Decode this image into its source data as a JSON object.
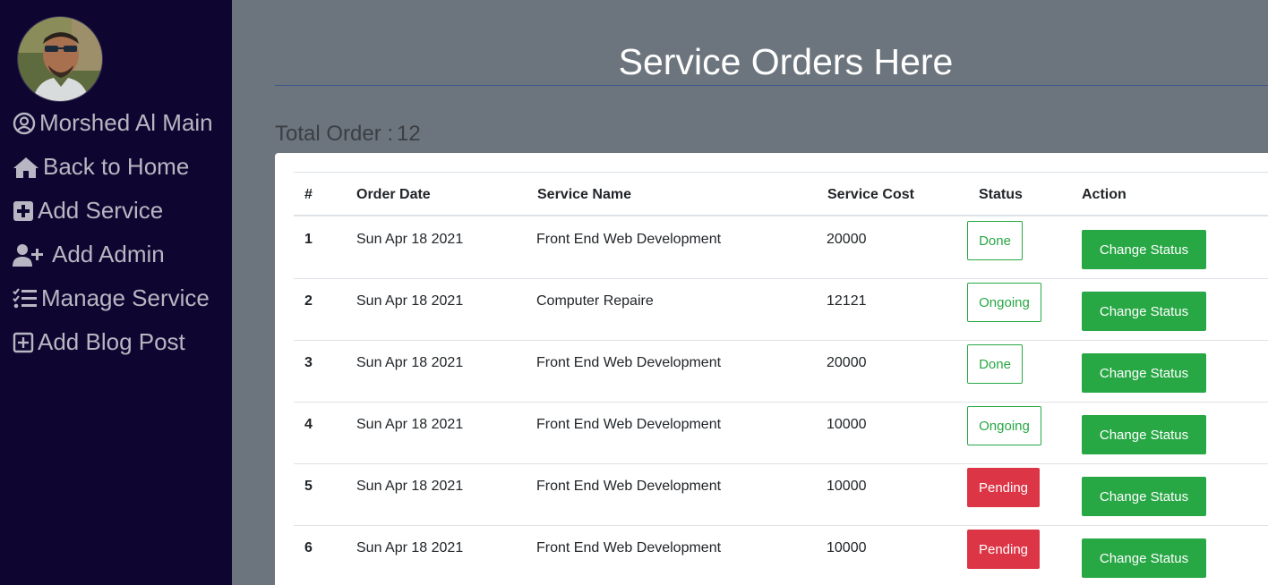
{
  "sidebar": {
    "user_name": "Morshed Al Main",
    "items": [
      {
        "label": "Back to Home",
        "icon": "home-icon"
      },
      {
        "label": "Add Service",
        "icon": "plus-square-icon"
      },
      {
        "label": "Add Admin",
        "icon": "user-plus-icon"
      },
      {
        "label": "Manage Service",
        "icon": "tasks-icon"
      },
      {
        "label": "Add Blog Post",
        "icon": "plus-square-outline-icon"
      }
    ]
  },
  "page": {
    "title": "Service Orders Here",
    "total_label": "Total Order :",
    "total_count": "12"
  },
  "table": {
    "headers": [
      "#",
      "Order Date",
      "Service Name",
      "Service Cost",
      "Status",
      "Action"
    ],
    "rows": [
      {
        "num": "1",
        "date": "Sun Apr 18 2021",
        "service": "Front End Web Development",
        "cost": "20000",
        "status": "Done",
        "action": "Change Status"
      },
      {
        "num": "2",
        "date": "Sun Apr 18 2021",
        "service": "Computer Repaire",
        "cost": "12121",
        "status": "Ongoing",
        "action": "Change Status"
      },
      {
        "num": "3",
        "date": "Sun Apr 18 2021",
        "service": "Front End Web Development",
        "cost": "20000",
        "status": "Done",
        "action": "Change Status"
      },
      {
        "num": "4",
        "date": "Sun Apr 18 2021",
        "service": "Front End Web Development",
        "cost": "10000",
        "status": "Ongoing",
        "action": "Change Status"
      },
      {
        "num": "5",
        "date": "Sun Apr 18 2021",
        "service": "Front End Web Development",
        "cost": "10000",
        "status": "Pending",
        "action": "Change Status"
      },
      {
        "num": "6",
        "date": "Sun Apr 18 2021",
        "service": "Front End Web Development",
        "cost": "10000",
        "status": "Pending",
        "action": "Change Status"
      }
    ]
  },
  "colors": {
    "sidebar_bg": "#0e0630",
    "main_bg": "#6c757d",
    "success": "#28a745",
    "danger": "#dc3545"
  }
}
